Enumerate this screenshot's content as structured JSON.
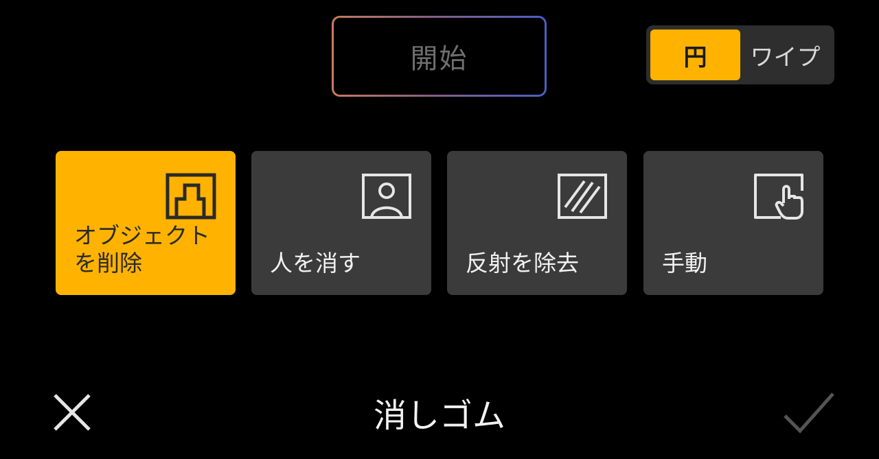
{
  "start_button": {
    "label": "開始"
  },
  "mode_toggle": {
    "options": [
      "円",
      "ワイプ"
    ],
    "selected": "円"
  },
  "tools": [
    {
      "label": "オブジェクト\nを削除",
      "icon": "remove-object-icon",
      "selected": true
    },
    {
      "label": "人を消す",
      "icon": "person-frame-icon",
      "selected": false
    },
    {
      "label": "反射を除去",
      "icon": "reflection-icon",
      "selected": false
    },
    {
      "label": "手動",
      "icon": "manual-hand-icon",
      "selected": false
    }
  ],
  "bottom_bar": {
    "title": "消しゴム",
    "close_icon": "close-icon",
    "confirm_icon": "check-icon"
  },
  "colors": {
    "accent": "#ffb300",
    "card": "#3b3b3b",
    "background": "#000000"
  }
}
